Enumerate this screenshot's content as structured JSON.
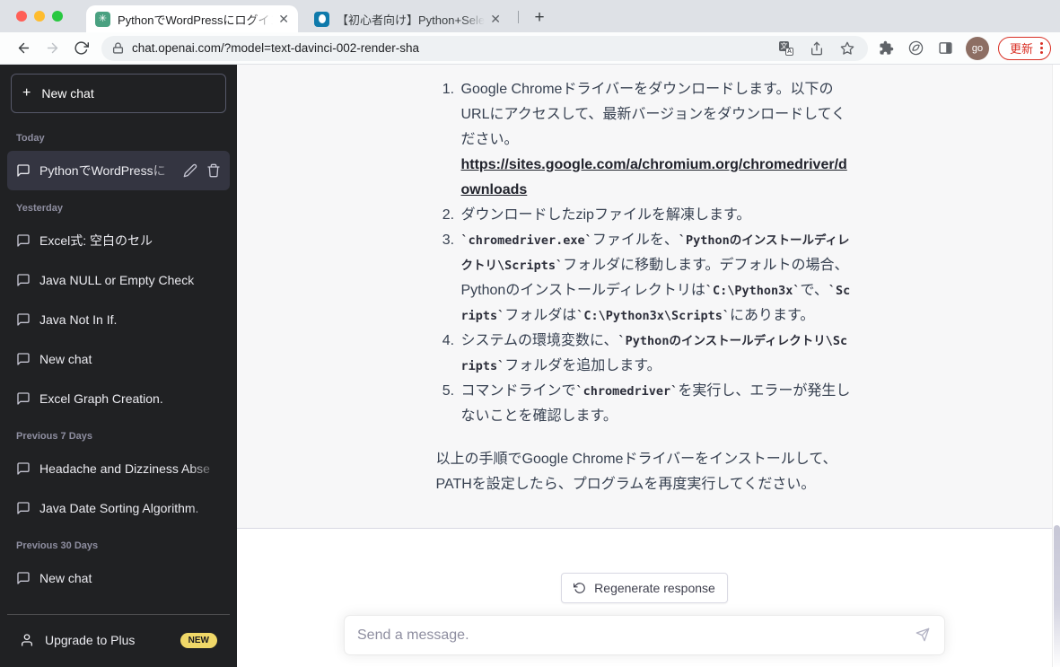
{
  "browser": {
    "tabs": [
      {
        "title": "PythonでWordPressにログイン",
        "favicon": "chatgpt-favicon"
      },
      {
        "title": "【初心者向け】Python+Selenium",
        "favicon": "blue-circle-favicon"
      }
    ],
    "url": "chat.openai.com/?model=text-davinci-002-render-sha",
    "avatar_text": "go",
    "update_label": "更新"
  },
  "colors": {
    "update_red": "#d93025",
    "chatgpt_favicon_teal": "#4aa181",
    "second_favicon_blue": "#0f7aab",
    "sidebar_bg": "#202123",
    "assistant_bubble_bg": "#f7f7f8",
    "new_badge_yellow": "#f0d868"
  },
  "sidebar": {
    "new_chat_label": "New chat",
    "sections": [
      {
        "label": "Today",
        "items": [
          {
            "label": "PythonでWordPressに"
          }
        ]
      },
      {
        "label": "Yesterday",
        "items": [
          {
            "label": "Excel式: 空白のセル"
          },
          {
            "label": "Java NULL or Empty Check"
          },
          {
            "label": "Java Not In If."
          },
          {
            "label": "New chat"
          },
          {
            "label": "Excel Graph Creation."
          }
        ]
      },
      {
        "label": "Previous 7 Days",
        "items": [
          {
            "label": "Headache and Dizziness Abse"
          },
          {
            "label": "Java Date Sorting Algorithm."
          }
        ]
      },
      {
        "label": "Previous 30 Days",
        "items": [
          {
            "label": "New chat"
          }
        ]
      }
    ],
    "upgrade_label": "Upgrade to Plus",
    "new_badge": "NEW"
  },
  "chat": {
    "steps": {
      "s1": {
        "text": "Google Chromeドライバーをダウンロードします。以下のURLにアクセスして、最新バージョンをダウンロードしてください。",
        "link": "https://sites.google.com/a/chromium.org/chromedriver/downloads"
      },
      "s2": {
        "text": "ダウンロードしたzipファイルを解凍します。"
      },
      "s3": {
        "c1": "`chromedriver.exe`",
        "t1": "ファイルを、",
        "c2": "`Pythonのインストールディレクトリ\\Scripts`",
        "t2": "フォルダに移動します。デフォルトの場合、Pythonのインストールディレクトリは",
        "c3": "`C:\\Python3x`",
        "t3": "で、",
        "c4": "`Scripts`",
        "t4": "フォルダは",
        "c5": "`C:\\Python3x\\Scripts`",
        "t5": "にあります。"
      },
      "s4": {
        "t1": "システムの環境変数に、",
        "c1": "`Pythonのインストールディレクトリ\\Scripts`",
        "t2": "フォルダを追加します。"
      },
      "s5": {
        "t1": "コマンドラインで",
        "c1": "`chromedriver`",
        "t2": "を実行し、エラーが発生しないことを確認します。"
      }
    },
    "closing": "以上の手順でGoogle Chromeドライバーをインストールして、PATHを設定したら、プログラムを再度実行してください。",
    "regenerate_label": "Regenerate response",
    "input_placeholder": "Send a message."
  }
}
